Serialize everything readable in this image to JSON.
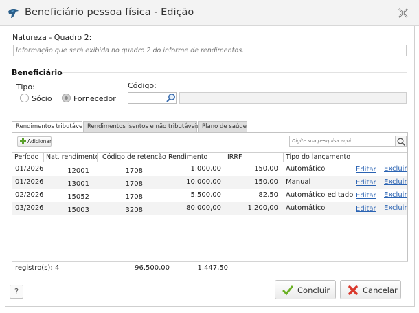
{
  "window": {
    "title": "Beneficiário pessoa física - Edição"
  },
  "natureza": {
    "label": "Natureza - Quadro 2:",
    "placeholder": "Informação que será exibida no quadro 2 do informe de rendimentos."
  },
  "beneficiario": {
    "section_title": "Beneficiário",
    "tipo_label": "Tipo:",
    "options": [
      "Sócio",
      "Fornecedor"
    ],
    "selected": "Fornecedor",
    "codigo_label": "Código:",
    "codigo_value": ""
  },
  "tabs": [
    {
      "label": "Rendimentos tributáveis",
      "active": true
    },
    {
      "label": "Rendimentos isentos e não tributáveis",
      "active": false
    },
    {
      "label": "Plano de saúde",
      "active": false
    }
  ],
  "toolbar": {
    "add_label": "Adicionar",
    "search_placeholder": "Digite sua pesquisa aqui..."
  },
  "table": {
    "columns": [
      "Período",
      "Nat. rendimento",
      "Código de retenção",
      "Rendimento",
      "IRRF",
      "Tipo do lançamento",
      "",
      ""
    ],
    "rows": [
      {
        "periodo": "01/2026",
        "nat": "12001",
        "codigo": "1708",
        "rendimento": "1.000,00",
        "irrf": "150,00",
        "tipo": "Automático",
        "editar": "Editar",
        "excluir": "Excluir"
      },
      {
        "periodo": "01/2026",
        "nat": "13001",
        "codigo": "1708",
        "rendimento": "10.000,00",
        "irrf": "150,00",
        "tipo": "Manual",
        "editar": "Editar",
        "excluir": "Excluir"
      },
      {
        "periodo": "02/2026",
        "nat": "15052",
        "codigo": "1708",
        "rendimento": "5.500,00",
        "irrf": "82,50",
        "tipo": "Automático editado",
        "editar": "Editar",
        "excluir": "Excluir"
      },
      {
        "periodo": "03/2026",
        "nat": "15003",
        "codigo": "3208",
        "rendimento": "80.000,00",
        "irrf": "1.200,00",
        "tipo": "Automático",
        "editar": "Editar",
        "excluir": "Excluir"
      }
    ]
  },
  "footer": {
    "count": "registro(s): 4",
    "total_rendimento": "96.500,00",
    "total_irrf": "1.447,50"
  },
  "buttons": {
    "help": "?",
    "concluir": "Concluir",
    "cancelar": "Cancelar"
  },
  "colors": {
    "link": "#2a63b3",
    "confirm": "#6ab023",
    "cancel": "#d9382c"
  }
}
